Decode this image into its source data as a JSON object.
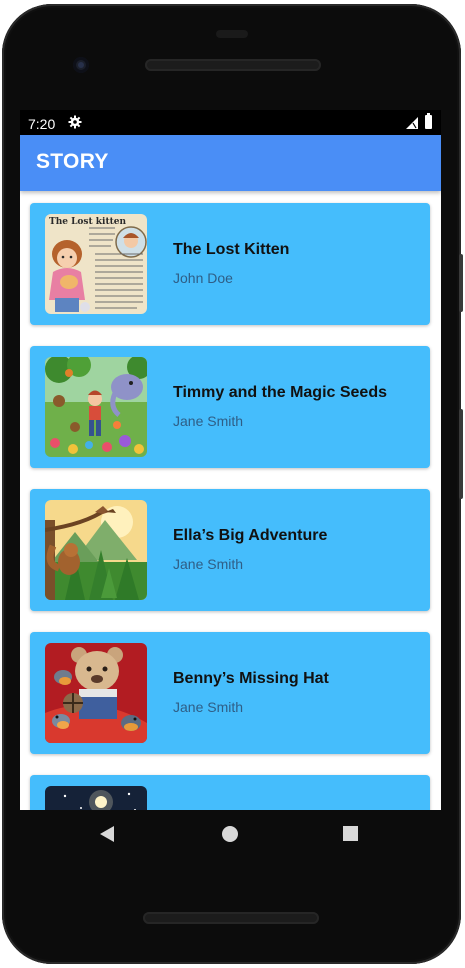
{
  "status_bar": {
    "time": "7:20",
    "icons": [
      "gear-icon",
      "signal-icon",
      "battery-icon"
    ]
  },
  "app_bar": {
    "title": "STORY",
    "color": "#4a8ef6"
  },
  "card_color": "#45bdfc",
  "stories": [
    {
      "title": "The Lost Kitten",
      "author": "John Doe",
      "thumb_title": "The Lost kitten"
    },
    {
      "title": "Timmy and the Magic Seeds",
      "author": "Jane Smith"
    },
    {
      "title": "Ella’s Big Adventure",
      "author": "Jane Smith"
    },
    {
      "title": "Benny’s Missing Hat",
      "author": "Jane Smith"
    },
    {
      "title": "",
      "author": ""
    }
  ],
  "nav_bar": {
    "icons": [
      "back-icon",
      "home-icon",
      "recents-icon"
    ]
  }
}
